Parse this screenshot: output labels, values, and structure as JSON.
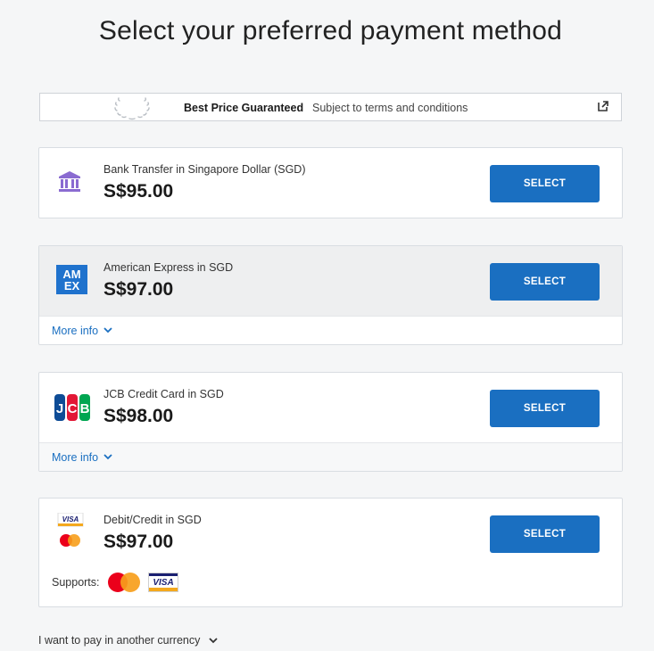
{
  "page": {
    "title": "Select your preferred payment method"
  },
  "banner": {
    "bold_text": "Best Price Guaranteed",
    "sub_text": "Subject to terms and conditions",
    "icons": [
      "laurel-icon",
      "external-link-icon"
    ]
  },
  "methods": [
    {
      "name": "Bank Transfer in Singapore Dollar (SGD)",
      "price": "S$95.00",
      "button": "SELECT",
      "icon": "bank-icon"
    },
    {
      "name": "American Express in SGD",
      "price": "S$97.00",
      "button": "SELECT",
      "icon": "amex-logo",
      "more_info": "More info"
    },
    {
      "name": "JCB Credit Card in SGD",
      "price": "S$98.00",
      "button": "SELECT",
      "icon": "jcb-logo",
      "more_info": "More info"
    },
    {
      "name": "Debit/Credit in SGD",
      "price": "S$97.00",
      "button": "SELECT",
      "icon": "visa-mastercard-logo",
      "supports_label": "Supports:"
    }
  ],
  "footer": {
    "another_currency": "I want to pay in another currency"
  },
  "colors": {
    "accent": "#1a6fc1",
    "bank_icon": "#8a6bd1",
    "amex": "#1f72cd"
  }
}
